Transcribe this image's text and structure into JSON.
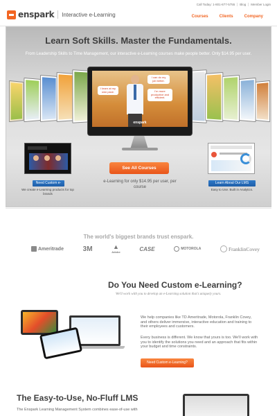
{
  "header": {
    "logo_text": "enspark",
    "tagline": "Interactive e-Learning",
    "util_links": [
      "Call Today: 1-801-877-5755",
      "Blog",
      "Member Login"
    ],
    "nav": [
      "Courses",
      "Clients",
      "Company"
    ]
  },
  "hero": {
    "title": "Learn Soft Skills. Master the Fundamentals.",
    "subtitle": "From Leadership Skills to Time Management, our interactive e-Learning courses make people better. Only $14.95 per user.",
    "bubbles": [
      "I can do my job better.",
      "I learn at my own pace.",
      "I'm more productive and efficient."
    ],
    "screen_brand": "enspark",
    "cta_main": "See All Courses",
    "price_note": "e-Learning for only $14.95 per user, per course",
    "left_button": "Need Custom e-",
    "left_note": "We create e-Learning products for top brands",
    "right_button": "Learn About Our LMS",
    "right_note": "Easy to Use. Built in Analytics."
  },
  "brands": {
    "title": "The world's biggest brands trust enspark.",
    "items": [
      "Ameritrade",
      "3M",
      "Adobe",
      "CASE",
      "MOTOROLA",
      "FranklinCovey"
    ]
  },
  "custom": {
    "title": "Do You Need Custom e-Learning?",
    "subtitle": "We'll work with you to develop an e-Learning solution that's uniquely yours.",
    "para1": "We help companies like TD Ameritrade, Motorola, Franklin Covey, and others deliver immersive, interactive education and training to their employees and customers.",
    "para2": "Every business is different. We know that yours is too. We'll work with you to identify the solutions you need and an approach that fits within your budget and time constraints.",
    "button": "Need Custom e-Learning?"
  },
  "lms": {
    "title": "The Easy-to-Use, No-Fluff LMS",
    "para": "The Enspark Learning Management System combines ease-of-use with"
  }
}
